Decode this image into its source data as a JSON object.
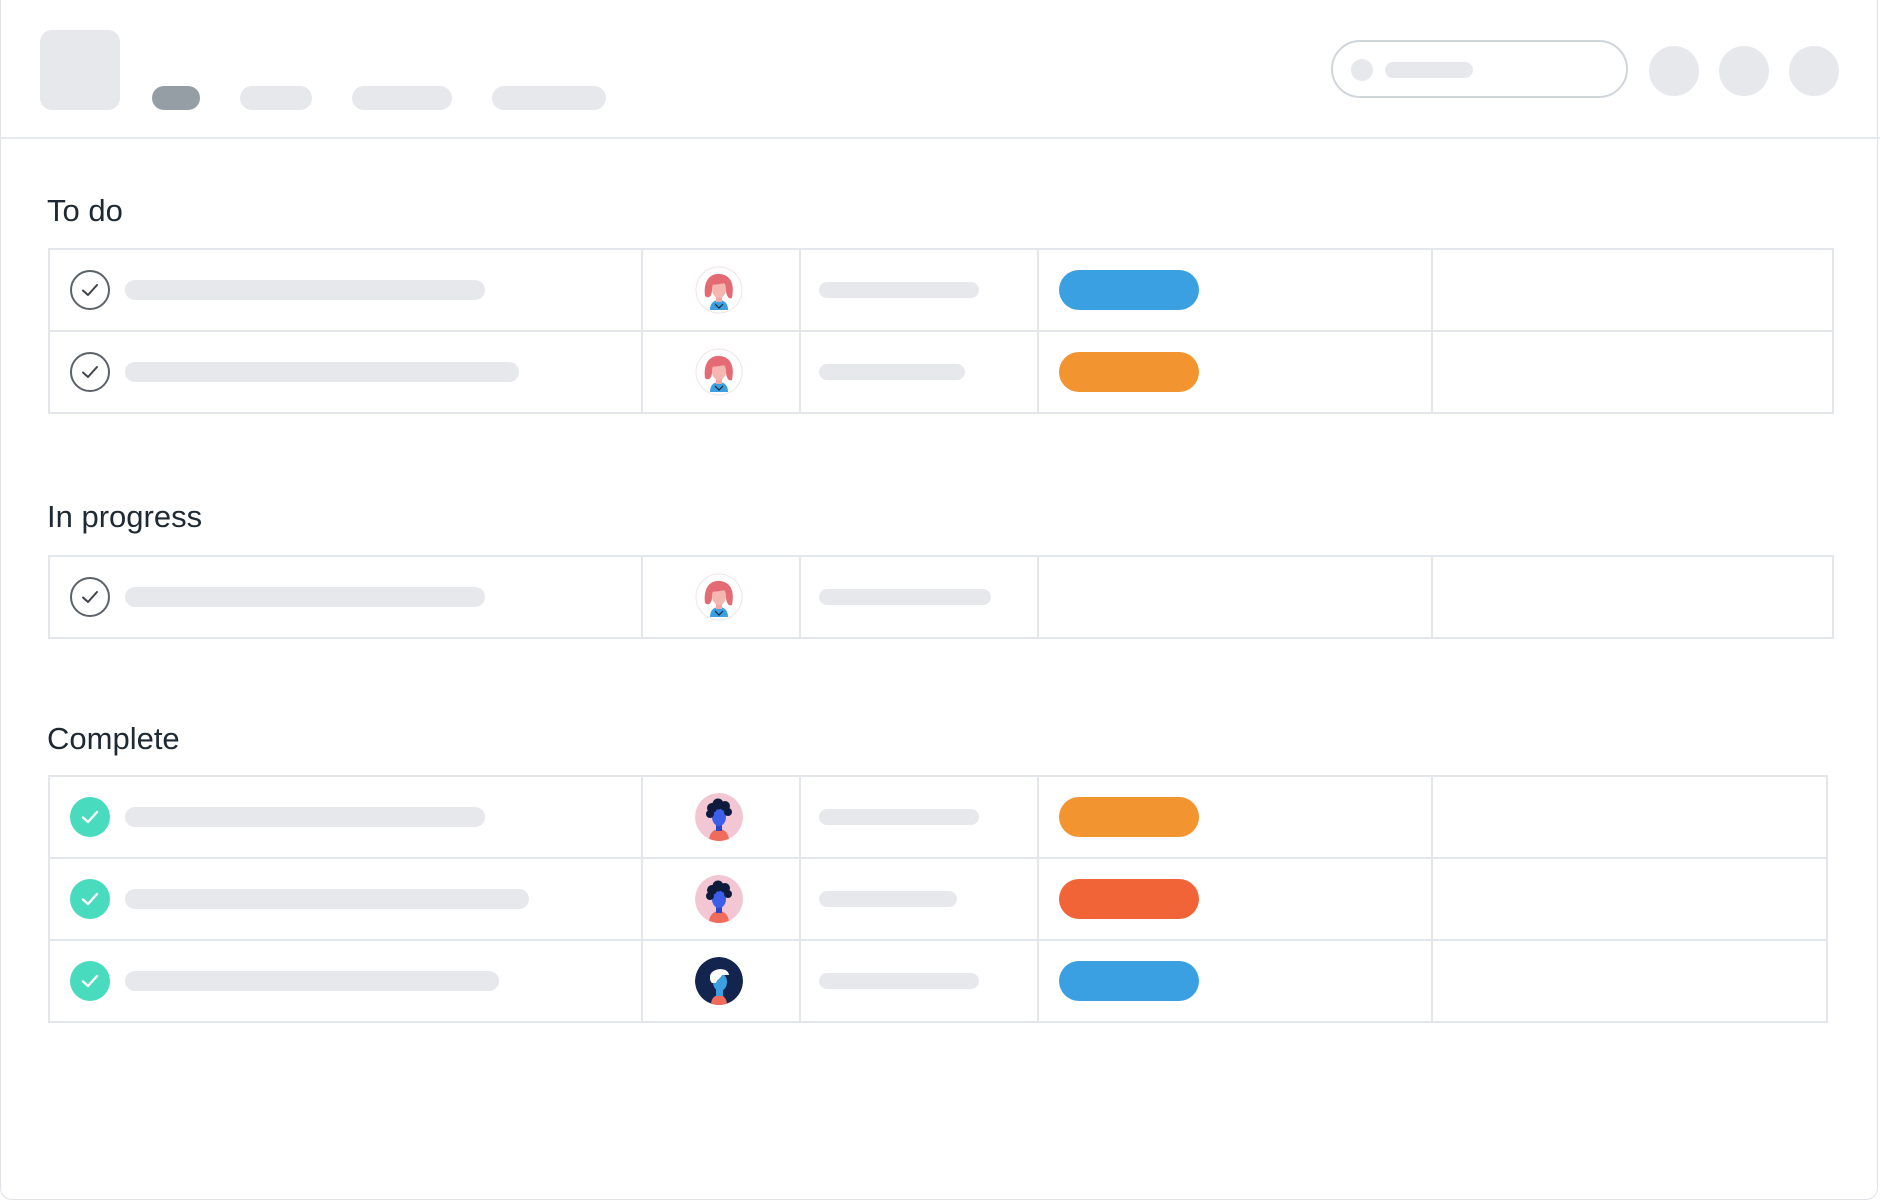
{
  "header": {
    "nav_tabs": [
      {
        "label": "",
        "active": true
      },
      {
        "label": "",
        "active": false
      },
      {
        "label": "",
        "active": false
      },
      {
        "label": "",
        "active": false
      }
    ],
    "search": {
      "placeholder": ""
    },
    "action_icons": [
      "profile-icon",
      "notifications-icon",
      "settings-icon"
    ]
  },
  "colors": {
    "blue": "#3aa0e2",
    "orange": "#f29430",
    "red": "#f06438",
    "done_check": "#48dbbd"
  },
  "sections": [
    {
      "title": "To do",
      "tasks": [
        {
          "done": false,
          "assignee": "red-haired-woman-avatar",
          "tag_color": "#3aa0e2"
        },
        {
          "done": false,
          "assignee": "red-haired-woman-avatar",
          "tag_color": "#f29430"
        }
      ]
    },
    {
      "title": "In progress",
      "tasks": [
        {
          "done": false,
          "assignee": "red-haired-woman-avatar",
          "tag_color": ""
        }
      ]
    },
    {
      "title": "Complete",
      "tasks": [
        {
          "done": true,
          "assignee": "curly-haired-person-avatar",
          "tag_color": "#f29430"
        },
        {
          "done": true,
          "assignee": "curly-haired-person-avatar",
          "tag_color": "#f06438"
        },
        {
          "done": true,
          "assignee": "blue-haired-person-avatar",
          "tag_color": "#3aa0e2"
        }
      ]
    }
  ]
}
